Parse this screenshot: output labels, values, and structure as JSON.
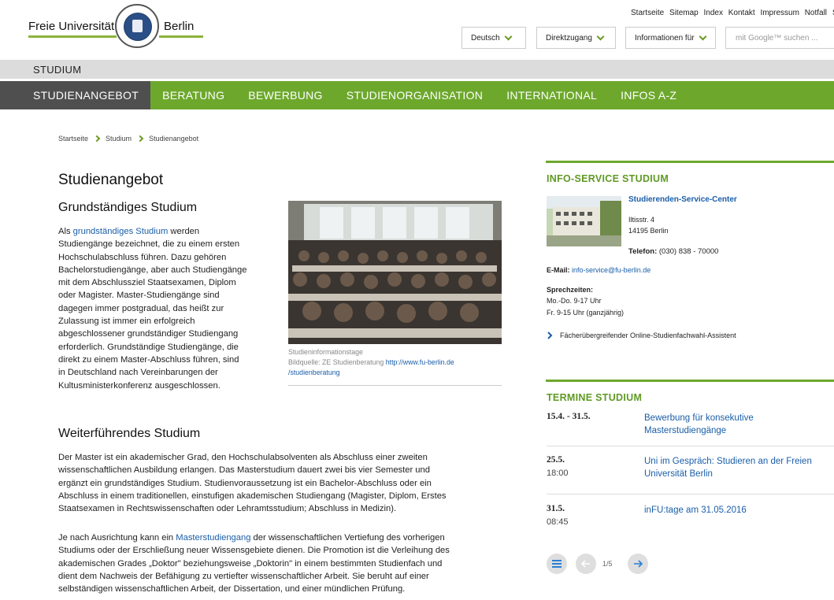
{
  "header": {
    "logo_left": "Freie Universität",
    "logo_right": "Berlin",
    "service_links": [
      "Startseite",
      "Sitemap",
      "Index",
      "Kontakt",
      "Impressum",
      "Notfall",
      "Se"
    ],
    "language": "Deutsch",
    "direct_access": "Direktzugang",
    "info_for": "Informationen für",
    "search_placeholder": "mit Google™ suchen ..."
  },
  "section_title": "STUDIUM",
  "nav": [
    "STUDIENANGEBOT",
    "BERATUNG",
    "BEWERBUNG",
    "STUDIENORGANISATION",
    "INTERNATIONAL",
    "INFOS A-Z"
  ],
  "breadcrumb": [
    "Startseite",
    "Studium",
    "Studienangebot"
  ],
  "main": {
    "title": "Studienangebot",
    "h_grund": "Grundständiges Studium",
    "grund_link": "grundständiges Studium",
    "grund_lines": [
      "Studiengänge bezeichnet, die zu einem ersten",
      "Hochschulabschluss führen. Dazu gehören",
      "Bachelorstudiengänge, aber auch Studiengänge",
      "mit dem Abschlussziel Staatsexamen, Diplom",
      "oder Magister. Master-Studiengänge sind",
      "dagegen immer postgradual, das heißt zur",
      "Zulassung ist immer ein erfolgreich",
      "abgeschlossener grundständiger Studiengang",
      "erforderlich. Grundständige Studiengänge, die",
      "direkt zu einem Master-Abschluss führen, sind",
      "in Deutschland nach Vereinbarungen der",
      "Kultusministerkonferenz ausgeschlossen."
    ],
    "grund_first_prefix": "Als",
    "grund_first_suffix": "werden",
    "caption_title": "Studieninformationstage",
    "caption_source": "Bildquelle: ZE Studienberatung",
    "caption_link": "http://www.fu-berlin.de /studienberatung",
    "h_weiter": "Weiterführendes Studium",
    "weiter_lines": [
      "Der Master ist ein akademischer Grad, den Hochschulabsolventen als Abschluss einer zweiten",
      "wissenschaftlichen Ausbildung erlangen. Das Masterstudium dauert zwei bis vier Semester und",
      "ergänzt ein grundständiges Studium. Studienvoraussetzung ist ein Bachelor-Abschluss oder ein",
      "Abschluss in einem traditionellen, einstufigen akademischen Studiengang (Magister, Diplom, Erstes",
      "Staatsexamen in Rechtswissenschaften oder Lehramtsstudium; Abschluss in Medizin)."
    ],
    "weiter2_prefix": "Je nach Ausrichtung kann ein",
    "weiter2_link": "Masterstudiengang",
    "weiter2_suffix": "der wissenschaftlichen Vertiefung des vorherigen",
    "weiter2_lines": [
      "Studiums oder der Erschließung neuer Wissensgebiete dienen. Die Promotion ist die Verleihung des",
      "akademischen Grades „Doktor\" beziehungsweise „Doktorin\" in einem bestimmten Studienfach und",
      "dient dem Nachweis der Befähigung zu vertiefter wissenschaftlicher Arbeit. Sie beruht auf einer",
      "selbständigen wissenschaftlichen Arbeit, der Dissertation, und einer mündlichen Prüfung."
    ]
  },
  "sidebar": {
    "info_title": "INFO-SERVICE STUDIUM",
    "ssc_name": "Studierenden-Service-Center",
    "street": "Iltisstr. 4",
    "city": "14195 Berlin",
    "phone_label": "Telefon:",
    "phone": "(030) 838 - 70000",
    "email_label": "E-Mail:",
    "email": "info-service@fu-berlin.de",
    "hours_label": "Sprechzeiten:",
    "hours_1": "Mo.-Do. 9-17 Uhr",
    "hours_2": "Fr. 9-15 Uhr (ganzjährig)",
    "assistant_link": "Fächerübergreifender Online-Studienfachwahl-Assistent",
    "termine_title": "TERMINE STUDIUM",
    "termine": [
      {
        "date": "15.4. - 31.5.",
        "time": "",
        "title": "Bewerbung für konsekutive Masterstudiengänge"
      },
      {
        "date": "25.5.",
        "time": "18:00",
        "title": "Uni im Gespräch: Studieren an der Freien Universität Berlin"
      },
      {
        "date": "31.5.",
        "time": "08:45",
        "title": "inFU:tage am 31.05.2016"
      }
    ],
    "pager": "1/5"
  },
  "colors": {
    "green": "#6da82c",
    "dark_tab": "#4f4f4f",
    "link": "#1a5ea8"
  }
}
